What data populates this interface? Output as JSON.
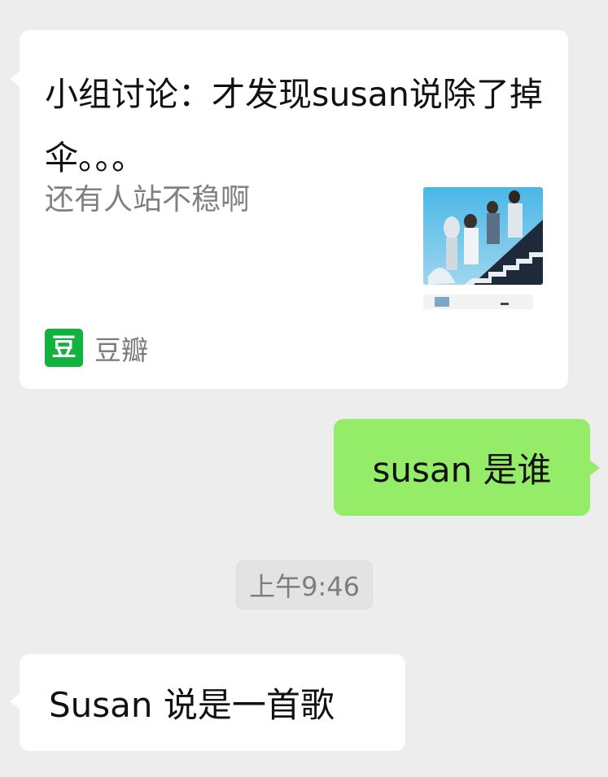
{
  "messages": {
    "link_card": {
      "title": "小组讨论：才发现susan说除了掉伞。。。",
      "description": "还有人站不稳啊",
      "source_icon_char": "豆",
      "source_name": "豆瓣",
      "source_color": "#12b23f"
    },
    "sent": {
      "text": "susan 是谁",
      "bubble_color": "#95ec69"
    },
    "timestamp": "上午9:46",
    "received": {
      "text": "Susan 说是一首歌"
    }
  },
  "colors": {
    "background": "#ededed",
    "incoming_bubble": "#ffffff",
    "outgoing_bubble": "#95ec69"
  }
}
